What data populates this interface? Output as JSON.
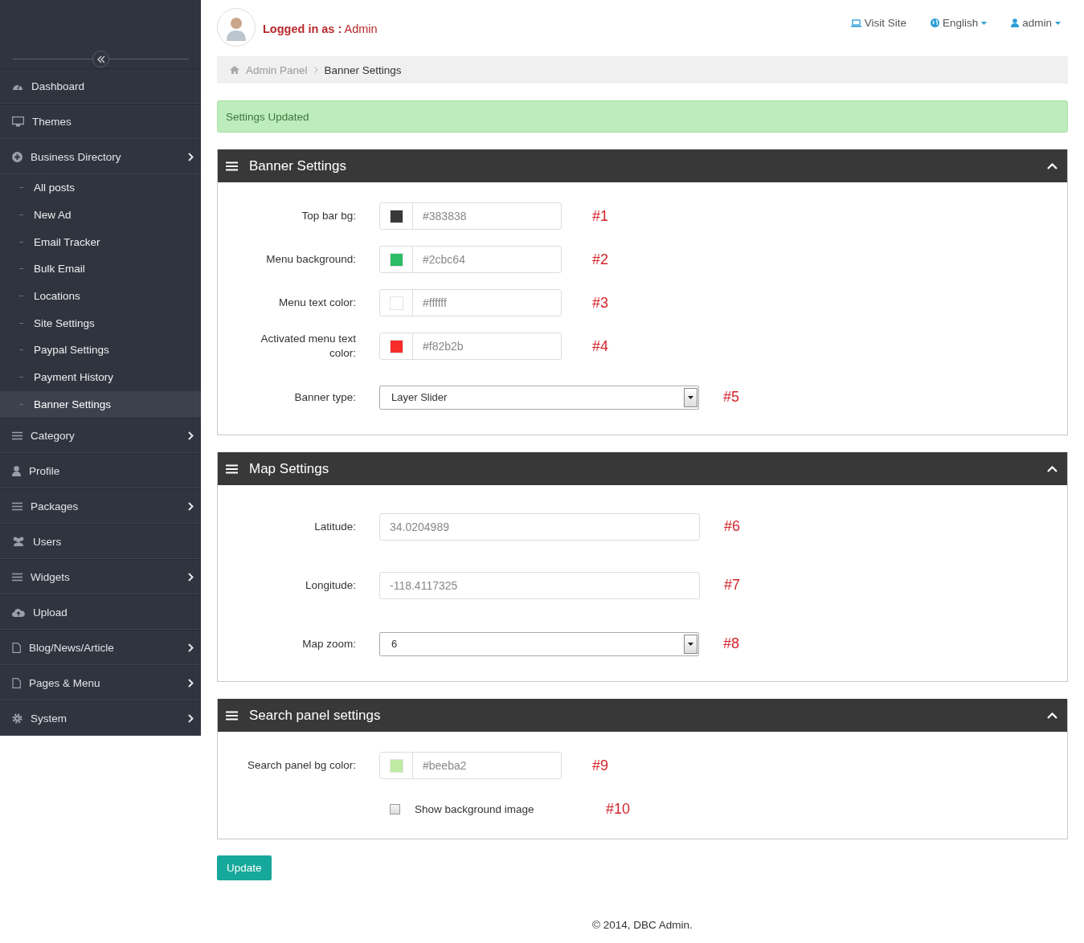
{
  "sidebar": {
    "items": [
      {
        "label": "Dashboard",
        "kind": "top",
        "has_children": false,
        "selected": false
      },
      {
        "label": "Themes",
        "kind": "top",
        "has_children": false,
        "selected": false
      },
      {
        "label": "Business Directory",
        "kind": "top",
        "has_children": true,
        "selected": false
      },
      {
        "label": "All posts",
        "kind": "sub",
        "selected": false
      },
      {
        "label": "New Ad",
        "kind": "sub",
        "selected": false
      },
      {
        "label": "Email Tracker",
        "kind": "sub",
        "selected": false
      },
      {
        "label": "Bulk Email",
        "kind": "sub",
        "selected": false
      },
      {
        "label": "Locations",
        "kind": "sub",
        "selected": false
      },
      {
        "label": "Site Settings",
        "kind": "sub",
        "selected": false
      },
      {
        "label": "Paypal Settings",
        "kind": "sub",
        "selected": false
      },
      {
        "label": "Payment History",
        "kind": "sub",
        "selected": false
      },
      {
        "label": "Banner Settings",
        "kind": "sub",
        "selected": true
      },
      {
        "label": "Category",
        "kind": "top",
        "has_children": true,
        "selected": false
      },
      {
        "label": "Profile",
        "kind": "top",
        "has_children": false,
        "selected": false
      },
      {
        "label": "Packages",
        "kind": "top",
        "has_children": true,
        "selected": false
      },
      {
        "label": "Users",
        "kind": "top",
        "has_children": false,
        "selected": false
      },
      {
        "label": "Widgets",
        "kind": "top",
        "has_children": true,
        "selected": false
      },
      {
        "label": "Upload",
        "kind": "top",
        "has_children": false,
        "selected": false
      },
      {
        "label": "Blog/News/Article",
        "kind": "top",
        "has_children": true,
        "selected": false
      },
      {
        "label": "Pages & Menu",
        "kind": "top",
        "has_children": true,
        "selected": false
      },
      {
        "label": "System",
        "kind": "top",
        "has_children": true,
        "selected": false
      }
    ]
  },
  "header": {
    "logged_in_label": "Logged in as :",
    "user": "Admin",
    "links": [
      {
        "label": "Visit Site",
        "dropdown": false
      },
      {
        "label": "English",
        "dropdown": true
      },
      {
        "label": "admin",
        "dropdown": true
      }
    ]
  },
  "breadcrumb": [
    "Admin Panel",
    "Banner Settings"
  ],
  "alert": "Settings Updated",
  "panels": [
    {
      "title": "Banner Settings",
      "fields": [
        {
          "kind": "color",
          "label": "Top bar bg:",
          "value": "#383838",
          "color": "#383838",
          "marker": "#1"
        },
        {
          "kind": "color",
          "label": "Menu background:",
          "value": "#2cbc64",
          "color": "#2cbc64",
          "marker": "#2"
        },
        {
          "kind": "color",
          "label": "Menu text color:",
          "value": "#ffffff",
          "color": "#ffffff",
          "marker": "#3"
        },
        {
          "kind": "color",
          "label": "Activated menu text color:",
          "value": "#f82b2b",
          "color": "#f82b2b",
          "marker": "#4"
        },
        {
          "kind": "select",
          "label": "Banner type:",
          "value": "Layer Slider",
          "marker": "#5"
        }
      ]
    },
    {
      "title": "Map Settings",
      "fields": [
        {
          "kind": "text",
          "label": "Latitude:",
          "value": "34.0204989",
          "marker": "#6"
        },
        {
          "kind": "text",
          "label": "Longitude:",
          "value": "-118.4117325",
          "marker": "#7"
        },
        {
          "kind": "select",
          "label": "Map zoom:",
          "value": "6",
          "marker": "#8"
        }
      ]
    },
    {
      "title": "Search panel settings",
      "fields": [
        {
          "kind": "color",
          "label": "Search panel bg color:",
          "value": "#beeba2",
          "color": "#beeba2",
          "marker": "#9"
        },
        {
          "kind": "checkbox",
          "label": "Show background image",
          "checked": false,
          "marker": "#10"
        }
      ]
    }
  ],
  "update_button": "Update",
  "footer": "© 2014, DBC Admin."
}
